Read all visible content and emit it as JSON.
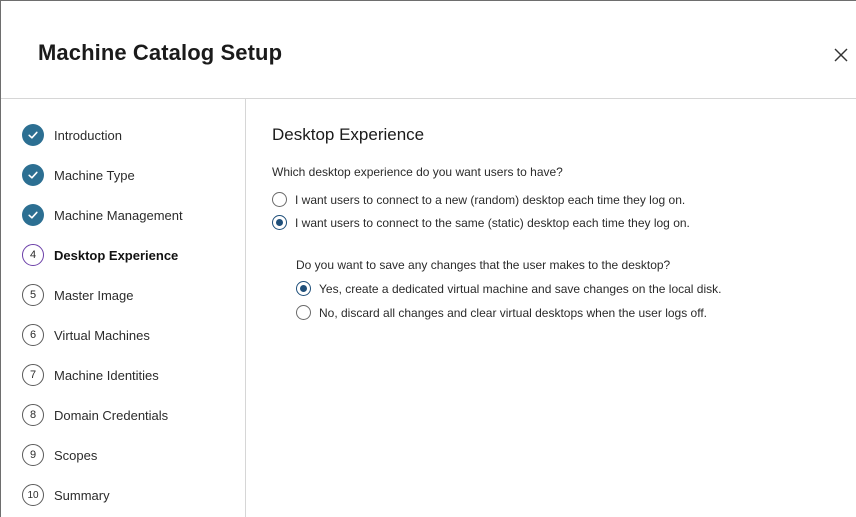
{
  "dialog": {
    "title": "Machine Catalog Setup",
    "close_icon": "close-icon"
  },
  "steps": [
    {
      "label": "Introduction",
      "state": "done",
      "number": ""
    },
    {
      "label": "Machine Type",
      "state": "done",
      "number": ""
    },
    {
      "label": "Machine Management",
      "state": "done",
      "number": ""
    },
    {
      "label": "Desktop Experience",
      "state": "current",
      "number": "4"
    },
    {
      "label": "Master Image",
      "state": "pending",
      "number": "5"
    },
    {
      "label": "Virtual Machines",
      "state": "pending",
      "number": "6"
    },
    {
      "label": "Machine Identities",
      "state": "pending",
      "number": "7"
    },
    {
      "label": "Domain Credentials",
      "state": "pending",
      "number": "8"
    },
    {
      "label": "Scopes",
      "state": "pending",
      "number": "9"
    },
    {
      "label": "Summary",
      "state": "pending",
      "number": "10"
    }
  ],
  "main": {
    "section_title": "Desktop Experience",
    "question1": "Which desktop experience do you want users to have?",
    "options1": [
      {
        "label": "I want users to connect to a new (random) desktop each time they log on.",
        "selected": false
      },
      {
        "label": "I want users to connect to the same (static) desktop each time they log on.",
        "selected": true
      }
    ],
    "question2": "Do you want to save any changes that the user makes to the desktop?",
    "options2": [
      {
        "label": "Yes, create a dedicated virtual machine and save changes on the local disk.",
        "selected": true
      },
      {
        "label": "No, discard all changes and clear virtual desktops when the user logs off.",
        "selected": false
      }
    ]
  },
  "colors": {
    "step_done": "#2c6f92",
    "step_current_ring": "#6b3fa8",
    "radio_selected": "#1f4f7a"
  }
}
